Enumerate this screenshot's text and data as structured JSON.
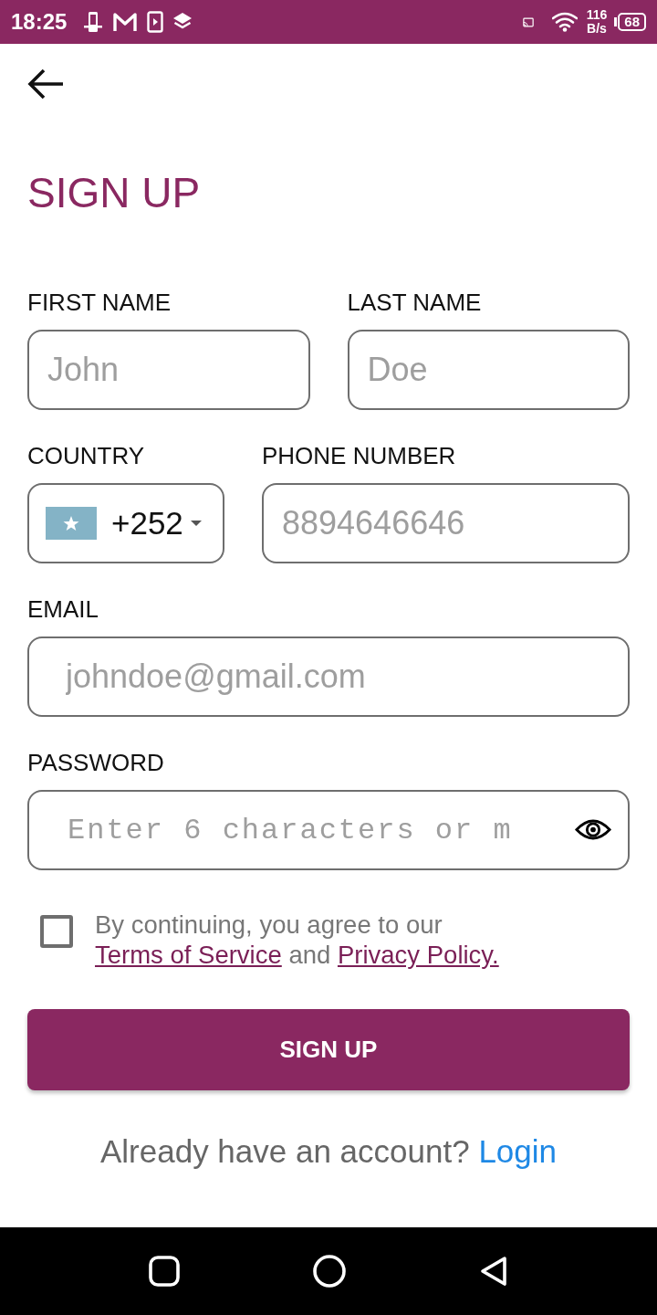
{
  "status_bar": {
    "time": "18:25",
    "speed_value": "116",
    "speed_unit": "B/s",
    "battery": "68"
  },
  "header": {
    "title": "SIGN UP"
  },
  "form": {
    "rows": [
      [
        {
          "kind": "text",
          "label": "FIRST NAME",
          "placeholder": "John"
        },
        {
          "kind": "text",
          "label": "LAST NAME",
          "placeholder": "Doe"
        }
      ],
      [
        {
          "kind": "country",
          "label": "COUNTRY",
          "code": "+252"
        },
        {
          "kind": "text",
          "label": "PHONE NUMBER",
          "placeholder": "8894646646"
        }
      ],
      [
        {
          "kind": "text",
          "label": "EMAIL",
          "placeholder": "johndoe@gmail.com"
        }
      ],
      [
        {
          "kind": "password",
          "label": "PASSWORD",
          "placeholder": "Enter 6 characters or m"
        }
      ]
    ]
  },
  "consent": {
    "checked": false,
    "text": "By continuing, you agree to our",
    "terms_link": "Terms of Service",
    "joiner": "and",
    "privacy_link": "Privacy Policy."
  },
  "submit_button": "SIGN UP",
  "login_prompt": {
    "text": "Already have an account?",
    "link": "Login"
  }
}
